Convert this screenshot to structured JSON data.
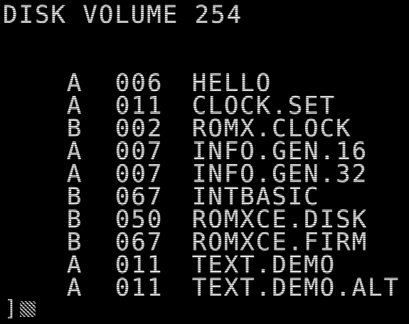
{
  "header": {
    "title": "DISK VOLUME 254"
  },
  "catalog": {
    "entries": [
      {
        "type": "A",
        "sectors": "006",
        "name": "HELLO"
      },
      {
        "type": "A",
        "sectors": "011",
        "name": "CLOCK.SET"
      },
      {
        "type": "B",
        "sectors": "002",
        "name": "ROMX.CLOCK"
      },
      {
        "type": "A",
        "sectors": "007",
        "name": "INFO.GEN.16"
      },
      {
        "type": "A",
        "sectors": "007",
        "name": "INFO.GEN.32"
      },
      {
        "type": "B",
        "sectors": "067",
        "name": "INTBASIC"
      },
      {
        "type": "B",
        "sectors": "050",
        "name": "ROMXCE.DISK"
      },
      {
        "type": "B",
        "sectors": "067",
        "name": "ROMXCE.FIRM"
      },
      {
        "type": "A",
        "sectors": "011",
        "name": "TEXT.DEMO"
      },
      {
        "type": "A",
        "sectors": "011",
        "name": "TEXT.DEMO.ALT"
      }
    ]
  },
  "prompt": {
    "symbol": "]"
  },
  "colors": {
    "foreground": "#e8e8e8",
    "background": "#000000"
  }
}
